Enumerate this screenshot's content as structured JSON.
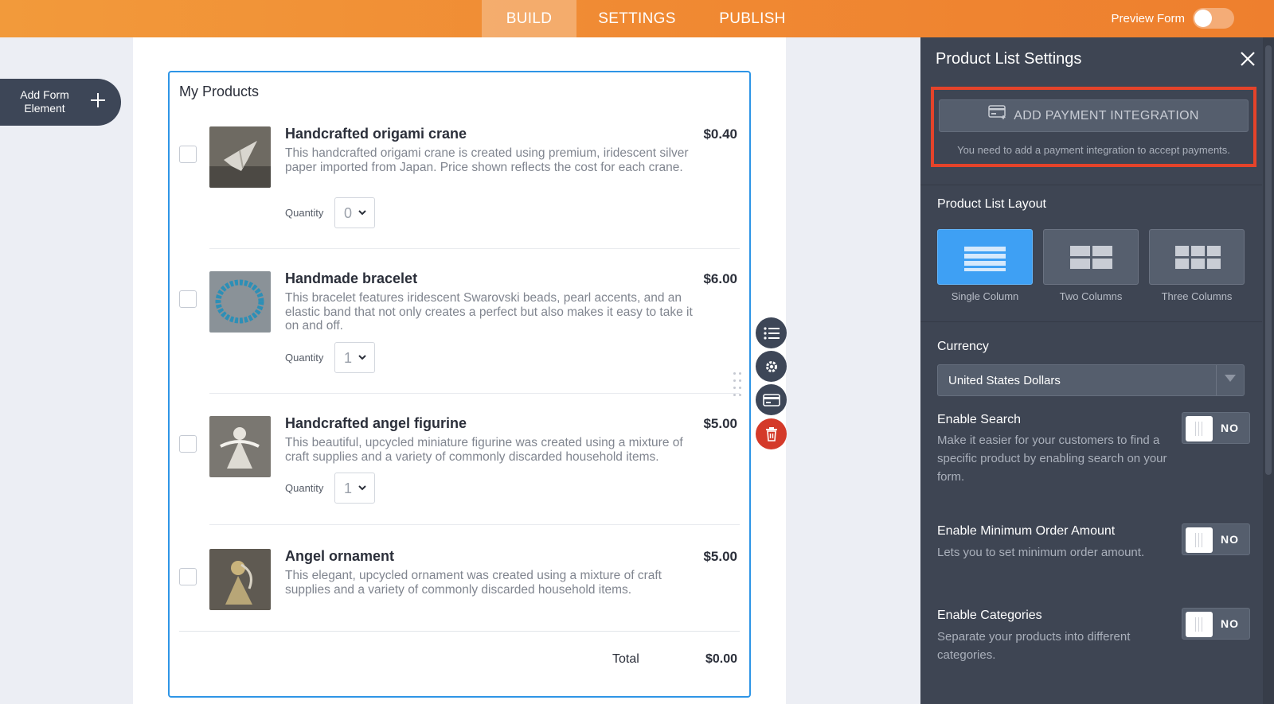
{
  "topbar": {
    "tabs": [
      {
        "label": "BUILD"
      },
      {
        "label": "SETTINGS"
      },
      {
        "label": "PUBLISH"
      }
    ],
    "preview_label": "Preview Form"
  },
  "sidebar": {
    "add_element_label": "Add Form Element"
  },
  "form": {
    "title": "My Products",
    "products": [
      {
        "name": "Handcrafted origami crane",
        "price": "$0.40",
        "description": "This handcrafted origami crane is created using premium, iridescent silver paper imported from Japan. Price shown reflects the cost for each crane.",
        "quantity_label": "Quantity",
        "quantity": "0"
      },
      {
        "name": "Handmade bracelet",
        "price": "$6.00",
        "description": "This bracelet features iridescent Swarovski beads, pearl accents, and an elastic band that not only creates a perfect but also makes it easy to take it on and off.",
        "quantity_label": "Quantity",
        "quantity": "1"
      },
      {
        "name": "Handcrafted angel figurine",
        "price": "$5.00",
        "description": "This beautiful, upcycled miniature figurine was created using a mixture of craft supplies and a variety of commonly discarded household items.",
        "quantity_label": "Quantity",
        "quantity": "1"
      },
      {
        "name": "Angel ornament",
        "price": "$5.00",
        "description": "This elegant, upcycled ornament was created using a mixture of craft supplies and a variety of commonly discarded household items."
      }
    ],
    "total_label": "Total",
    "total_value": "$0.00"
  },
  "panel": {
    "title": "Product List Settings",
    "payment_button": "ADD PAYMENT INTEGRATION",
    "payment_note": "You need to add a payment integration to accept payments.",
    "layout_title": "Product List Layout",
    "layouts": [
      "Single Column",
      "Two Columns",
      "Three Columns"
    ],
    "currency_label": "Currency",
    "currency_value": "United States Dollars",
    "options": [
      {
        "title": "Enable Search",
        "description": "Make it easier for your customers to find a specific product by enabling search on your form.",
        "state": "NO"
      },
      {
        "title": "Enable Minimum Order Amount",
        "description": "Lets you to set minimum order amount.",
        "state": "NO"
      },
      {
        "title": "Enable Categories",
        "description": "Separate your products into different categories.",
        "state": "NO"
      }
    ]
  },
  "colors": {
    "accent": "#f08a33",
    "panel_bg": "#3e4553",
    "highlight_border": "#e5432a",
    "selection_border": "#2e95e6",
    "active_layout": "#3ea0f4",
    "delete": "#d43a2a"
  },
  "icons": [
    "plus-icon",
    "close-icon",
    "credit-card-icon",
    "list-icon",
    "gear-icon",
    "delete-icon",
    "chevron-down-icon",
    "drag-handle-icon"
  ]
}
